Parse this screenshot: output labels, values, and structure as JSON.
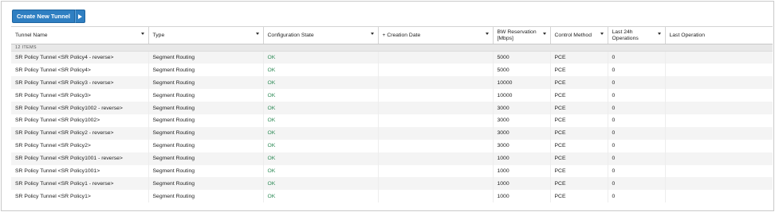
{
  "toolbar": {
    "create_label": "Create New Tunnel"
  },
  "table": {
    "columns": [
      "Tunnel Name",
      "Type",
      "Configuration State",
      "+ Creation Date",
      "BW Reservation [Mbps]",
      "Control Method",
      "Last 24h Operations",
      "Last Operation"
    ],
    "group_label": "12 ITEMS",
    "rows": [
      {
        "name": "SR Policy Tunnel <SR Policy4 - reverse>",
        "type": "Segment Routing",
        "state": "OK",
        "date": "",
        "bw": "5000",
        "method": "PCE",
        "ops": "0",
        "last": ""
      },
      {
        "name": "SR Policy Tunnel <SR Policy4>",
        "type": "Segment Routing",
        "state": "OK",
        "date": "",
        "bw": "5000",
        "method": "PCE",
        "ops": "0",
        "last": ""
      },
      {
        "name": "SR Policy Tunnel <SR Policy3 - reverse>",
        "type": "Segment Routing",
        "state": "OK",
        "date": "",
        "bw": "10000",
        "method": "PCE",
        "ops": "0",
        "last": ""
      },
      {
        "name": "SR Policy Tunnel <SR Policy3>",
        "type": "Segment Routing",
        "state": "OK",
        "date": "",
        "bw": "10000",
        "method": "PCE",
        "ops": "0",
        "last": ""
      },
      {
        "name": "SR Policy Tunnel <SR Policy1002 - reverse>",
        "type": "Segment Routing",
        "state": "OK",
        "date": "",
        "bw": "3000",
        "method": "PCE",
        "ops": "0",
        "last": ""
      },
      {
        "name": "SR Policy Tunnel <SR Policy1002>",
        "type": "Segment Routing",
        "state": "OK",
        "date": "",
        "bw": "3000",
        "method": "PCE",
        "ops": "0",
        "last": ""
      },
      {
        "name": "SR Policy Tunnel <SR Policy2 - reverse>",
        "type": "Segment Routing",
        "state": "OK",
        "date": "",
        "bw": "3000",
        "method": "PCE",
        "ops": "0",
        "last": ""
      },
      {
        "name": "SR Policy Tunnel <SR Policy2>",
        "type": "Segment Routing",
        "state": "OK",
        "date": "",
        "bw": "3000",
        "method": "PCE",
        "ops": "0",
        "last": ""
      },
      {
        "name": "SR Policy Tunnel <SR Policy1001 - reverse>",
        "type": "Segment Routing",
        "state": "OK",
        "date": "",
        "bw": "1000",
        "method": "PCE",
        "ops": "0",
        "last": ""
      },
      {
        "name": "SR Policy Tunnel <SR Policy1001>",
        "type": "Segment Routing",
        "state": "OK",
        "date": "",
        "bw": "1000",
        "method": "PCE",
        "ops": "0",
        "last": ""
      },
      {
        "name": "SR Policy Tunnel <SR Policy1 - reverse>",
        "type": "Segment Routing",
        "state": "OK",
        "date": "",
        "bw": "1000",
        "method": "PCE",
        "ops": "0",
        "last": ""
      },
      {
        "name": "SR Policy Tunnel <SR Policy1>",
        "type": "Segment Routing",
        "state": "OK",
        "date": "",
        "bw": "1000",
        "method": "PCE",
        "ops": "0",
        "last": ""
      }
    ]
  },
  "colors": {
    "accent": "#2f7fc2",
    "ok": "#2e8b57"
  },
  "icons": {
    "create_menu": "play-arrow-icon",
    "sort": "sort-caret-icon"
  }
}
